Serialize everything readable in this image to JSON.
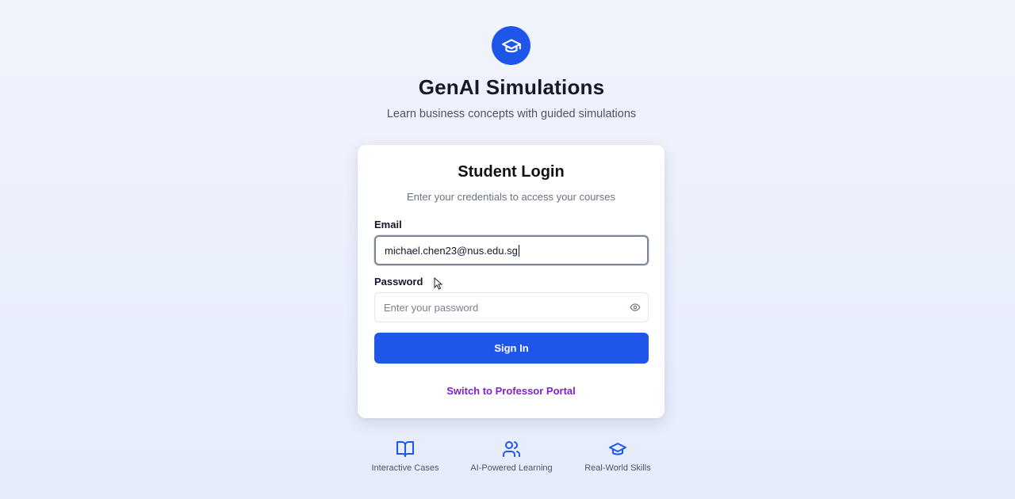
{
  "brand": {
    "logo_icon": "graduation-cap-icon",
    "title": "GenAI Simulations",
    "subtitle": "Learn business concepts with guided simulations",
    "accent_color": "#1f56ea"
  },
  "login_card": {
    "title": "Student Login",
    "subtitle": "Enter your credentials to access your courses",
    "email": {
      "label": "Email",
      "value": "michael.chen23@nus.edu.sg"
    },
    "password": {
      "label": "Password",
      "placeholder": "Enter your password",
      "value": "",
      "toggle_icon": "eye-icon"
    },
    "submit_label": "Sign In",
    "switch_link": "Switch to Professor Portal",
    "link_color": "#7e22ce"
  },
  "features": [
    {
      "icon": "book-open-icon",
      "label": "Interactive Cases"
    },
    {
      "icon": "users-icon",
      "label": "AI-Powered Learning"
    },
    {
      "icon": "graduation-cap-icon",
      "label": "Real-World Skills"
    }
  ]
}
